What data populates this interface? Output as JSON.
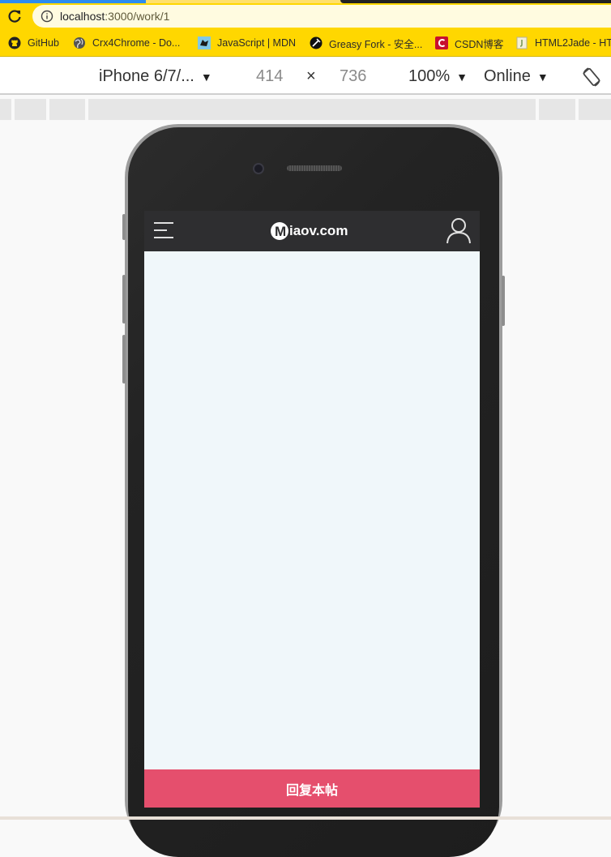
{
  "browser": {
    "url_host": "localhost",
    "url_path": ":3000/work/1",
    "bookmarks": [
      {
        "label": "GitHub",
        "icon": "github-icon"
      },
      {
        "label": "Crx4Chrome - Do...",
        "icon": "globe-icon"
      },
      {
        "label": "JavaScript | MDN",
        "icon": "mdn-icon"
      },
      {
        "label": "Greasy Fork - 安全...",
        "icon": "greasyfork-icon"
      },
      {
        "label": "CSDN博客",
        "icon": "csdn-icon"
      },
      {
        "label": "HTML2Jade - HT",
        "icon": "document-icon"
      }
    ]
  },
  "device_toolbar": {
    "device": "iPhone 6/7/...",
    "width": "414",
    "times": "×",
    "height": "736",
    "zoom": "100%",
    "network": "Online"
  },
  "app": {
    "logo_text": "iaov.com",
    "reply_button": "回复本帖"
  },
  "colors": {
    "browser_theme": "#ffd700",
    "app_header": "#2e2e30",
    "reply_bar": "#e54f6d",
    "content_bg": "#f0f7fa"
  }
}
